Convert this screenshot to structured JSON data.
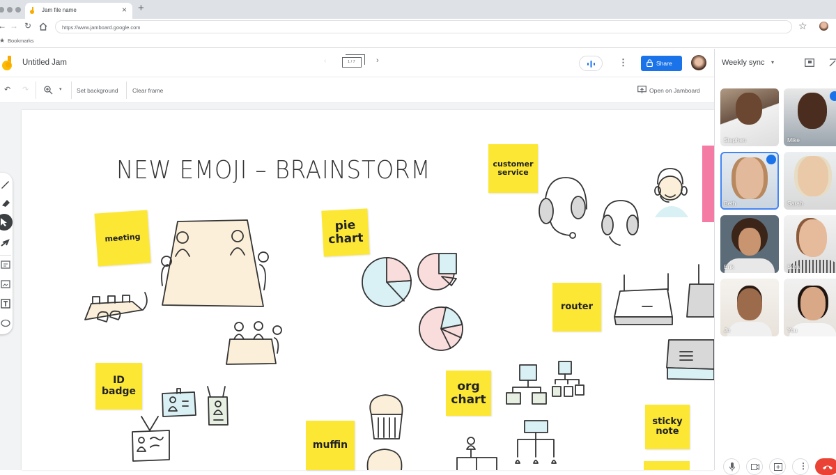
{
  "browser": {
    "tab_title": "Jam file name",
    "url": "https://www.jamboard.google.com",
    "bookmarks_label": "Bookmarks"
  },
  "app": {
    "doc_title": "Untitled Jam",
    "frame_indicator": "1 / 7",
    "share_label": "Share",
    "colors": {
      "accent": "#1a73e8",
      "sticky": "#fde735",
      "end_call": "#ea4335"
    }
  },
  "toolbar": {
    "set_background": "Set background",
    "clear_frame": "Clear frame",
    "open_on_jamboard": "Open on Jamboard"
  },
  "left_tools": [
    "pen",
    "eraser",
    "select",
    "laser",
    "sticky-note",
    "image",
    "text-box",
    "shape"
  ],
  "canvas": {
    "title": "NEW EMOJI – BRAINSTORM",
    "stickies": [
      {
        "text": "meeting"
      },
      {
        "text": "pie\nchart"
      },
      {
        "text": "customer\nservice"
      },
      {
        "text": "router"
      },
      {
        "text": "ID\nbadge"
      },
      {
        "text": "org\nchart"
      },
      {
        "text": "muffin"
      },
      {
        "text": "sticky\nnote"
      }
    ]
  },
  "meet": {
    "title": "Weekly sync",
    "participants": [
      {
        "name": "Stephen",
        "speaking": false
      },
      {
        "name": "Mike",
        "speaking": true
      },
      {
        "name": "Beth",
        "speaking": true
      },
      {
        "name": "Sarah",
        "speaking": false
      },
      {
        "name": "Erik",
        "speaking": false
      },
      {
        "name": "Sara",
        "speaking": false
      },
      {
        "name": "Jo",
        "speaking": false
      },
      {
        "name": "You",
        "speaking": false
      }
    ],
    "controls": [
      "microphone",
      "camera",
      "present",
      "more",
      "end-call"
    ]
  }
}
